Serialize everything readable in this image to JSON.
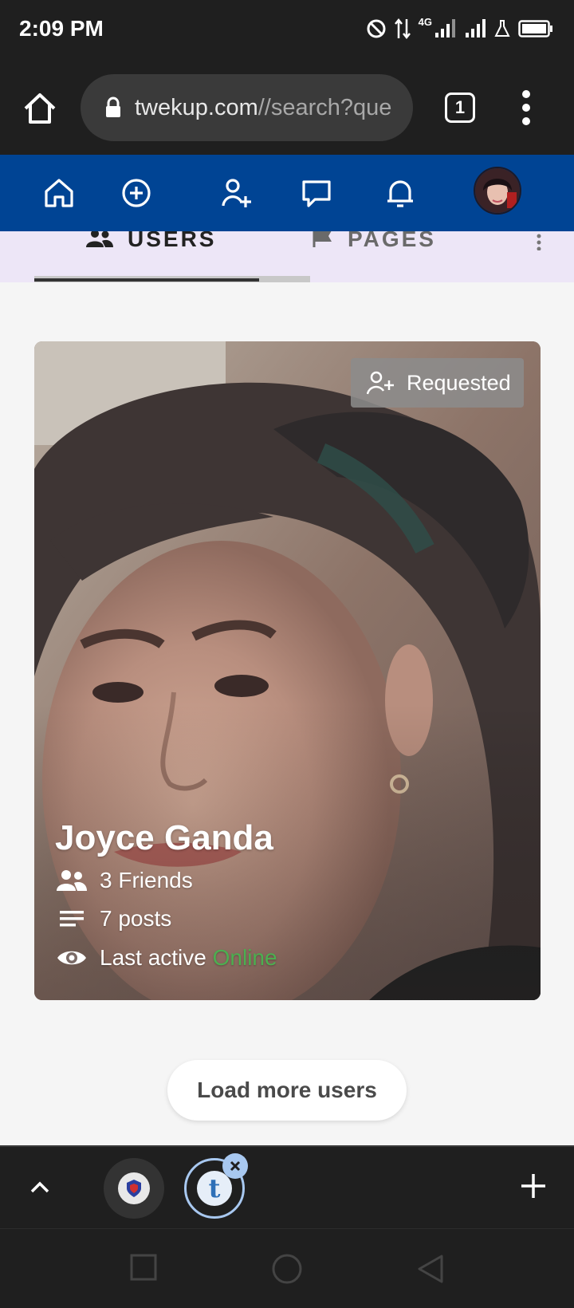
{
  "status_bar": {
    "time": "2:09 PM",
    "network": "4G"
  },
  "browser": {
    "url_domain": "twekup.com",
    "url_path": "//search?que",
    "tab_count": "1"
  },
  "tabs": [
    {
      "label": "USERS",
      "icon": "people-icon",
      "active": true
    },
    {
      "label": "PAGES",
      "icon": "flag-icon",
      "active": false
    }
  ],
  "user_card": {
    "request_label": "Requested",
    "name": "Joyce Ganda",
    "friends": "3 Friends",
    "posts": "7 posts",
    "last_active_label": "Last active",
    "last_active_value": "Online"
  },
  "load_more_label": "Load more users",
  "colors": {
    "app_nav": "#004494",
    "tabs_bg": "#ede6f7",
    "online": "#4caf50",
    "browser_chrome": "#1f1f1f"
  }
}
